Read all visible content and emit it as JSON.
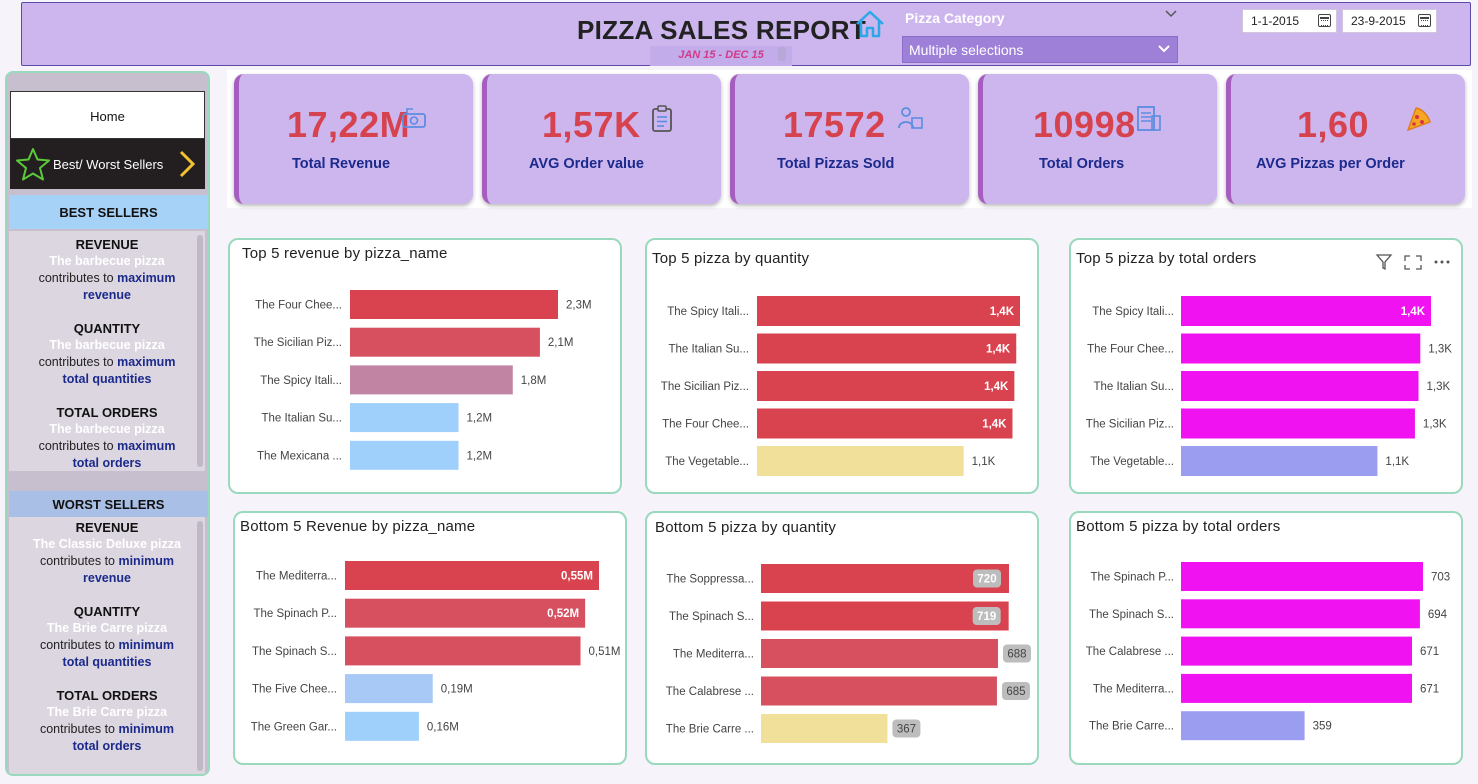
{
  "header": {
    "title": "PIZZA SALES REPORT",
    "subtitle": "JAN 15 - DEC 15",
    "category_label": "Pizza Category",
    "category_value": "Multiple selections",
    "date_start": "1-1-2015",
    "date_end": "23-9-2015"
  },
  "sidebar": {
    "home_label": "Home",
    "best_worst_label": "Best/ Worst Sellers",
    "best": {
      "heading": "BEST SELLERS",
      "blocks": [
        {
          "title": "REVENUE",
          "item": "The barbecue pizza",
          "mid": "contributes to ",
          "em1": "maximum",
          "em2": "revenue"
        },
        {
          "title": "QUANTITY",
          "item": "The barbecue pizza",
          "mid": "contributes to ",
          "em1": "maximum",
          "em2": "total quantities"
        },
        {
          "title": "TOTAL ORDERS",
          "item": "The barbecue pizza",
          "mid": "contributes to ",
          "em1": "maximum",
          "em2": "total orders"
        }
      ]
    },
    "worst": {
      "heading": "WORST SELLERS",
      "blocks": [
        {
          "title": "REVENUE",
          "item": "The Classic Deluxe pizza",
          "mid": "contributes to ",
          "em1": "minimum",
          "em2": "revenue"
        },
        {
          "title": "QUANTITY",
          "item": "The Brie Carre pizza",
          "mid": "contributes to ",
          "em1": "minimum",
          "em2": "total quantities"
        },
        {
          "title": "TOTAL ORDERS",
          "item": "The Brie Carre  pizza",
          "mid": "contributes to ",
          "em1": "minimum",
          "em2": "total orders"
        }
      ]
    }
  },
  "kpis": [
    {
      "value": "17,22M",
      "label": "Total Revenue",
      "icon": "money-hand-icon"
    },
    {
      "value": "1,57K",
      "label": "AVG Order value",
      "icon": "clipboard-icon"
    },
    {
      "value": "17572",
      "label": "Total Pizzas Sold",
      "icon": "delivery-person-icon"
    },
    {
      "value": "10998",
      "label": "Total Orders",
      "icon": "receipt-list-icon"
    },
    {
      "value": "1,60",
      "label": "AVG Pizzas per Order",
      "icon": "pizza-slice-icon"
    }
  ],
  "colors": {
    "red": "#d9434f",
    "red2": "#d65060",
    "mauve": "#c284a3",
    "lightblue": "#9fd0fb",
    "blue2": "#a8c8f5",
    "yellow": "#f0e09a",
    "magenta": "#f012f0",
    "periwinkle": "#9b9ef0"
  },
  "chart_data": [
    {
      "type": "bar",
      "orientation": "horizontal",
      "title": "Top 5 revenue by pizza_name",
      "categories": [
        "The Four Chee...",
        "The Sicilian Piz...",
        "The Spicy Itali...",
        "The Italian Su...",
        "The Mexicana ..."
      ],
      "values": [
        2.3,
        2.1,
        1.8,
        1.2,
        1.2
      ],
      "labels": [
        "2,3M",
        "2,1M",
        "1,8M",
        "1,2M",
        "1,2M"
      ],
      "max": 2.3,
      "colors": [
        "#d9434f",
        "#d65060",
        "#c284a3",
        "#9fd0fb",
        "#9fd0fb"
      ],
      "label_style": "outside"
    },
    {
      "type": "bar",
      "orientation": "horizontal",
      "title": "Top 5 pizza by quantity",
      "categories": [
        "The Spicy Itali...",
        "The Italian Su...",
        "The Sicilian Piz...",
        "The Four Chee...",
        "The Vegetable..."
      ],
      "values": [
        1.4,
        1.38,
        1.37,
        1.36,
        1.1
      ],
      "labels": [
        "1,4K",
        "1,4K",
        "1,4K",
        "1,4K",
        "1,1K"
      ],
      "max": 1.4,
      "colors": [
        "#d9434f",
        "#d9434f",
        "#d9434f",
        "#d9434f",
        "#f0e09a"
      ],
      "label_style": "inside-last-outside"
    },
    {
      "type": "bar",
      "orientation": "horizontal",
      "title": "Top 5 pizza by total orders",
      "categories": [
        "The Spicy Itali...",
        "The Four Chee...",
        "The Italian Su...",
        "The Sicilian Piz...",
        "The Vegetable..."
      ],
      "values": [
        1.4,
        1.34,
        1.33,
        1.31,
        1.1
      ],
      "labels": [
        "1,4K",
        "1,3K",
        "1,3K",
        "1,3K",
        "1,1K"
      ],
      "max": 1.4,
      "colors": [
        "#f012f0",
        "#f012f0",
        "#f012f0",
        "#f012f0",
        "#9b9ef0"
      ],
      "label_style": "inside-first"
    },
    {
      "type": "bar",
      "orientation": "horizontal",
      "title": "Bottom 5 Revenue by pizza_name",
      "categories": [
        "The Mediterra...",
        "The Spinach P...",
        "The Spinach S...",
        "The Five Chee...",
        "The Green Gar..."
      ],
      "values": [
        0.55,
        0.52,
        0.51,
        0.19,
        0.16
      ],
      "labels": [
        "0,55M",
        "0,52M",
        "0,51M",
        "0,19M",
        "0,16M"
      ],
      "max": 0.55,
      "colors": [
        "#d9434f",
        "#d65060",
        "#d65060",
        "#a8c8f5",
        "#9fd0fb"
      ],
      "label_style": "inside-first-two"
    },
    {
      "type": "bar",
      "orientation": "horizontal",
      "title": "Bottom 5 pizza by quantity",
      "categories": [
        "The Soppressa...",
        "The Spinach S...",
        "The Mediterra...",
        "The Calabrese ...",
        "The Brie Carre ..."
      ],
      "values": [
        720,
        719,
        688,
        685,
        367
      ],
      "labels": [
        "720",
        "719",
        "688",
        "685",
        "367"
      ],
      "max": 720,
      "colors": [
        "#d9434f",
        "#d9434f",
        "#d65060",
        "#d65060",
        "#f0e09a"
      ],
      "label_style": "pill"
    },
    {
      "type": "bar",
      "orientation": "horizontal",
      "title": "Bottom 5 pizza by total orders",
      "categories": [
        "The Spinach P...",
        "The Spinach S...",
        "The Calabrese ...",
        "The Mediterra...",
        "The Brie Carre..."
      ],
      "values": [
        703,
        694,
        671,
        671,
        359
      ],
      "labels": [
        "703",
        "694",
        "671",
        "671",
        "359"
      ],
      "max": 703,
      "colors": [
        "#f012f0",
        "#f012f0",
        "#f012f0",
        "#f012f0",
        "#9b9ef0"
      ],
      "label_style": "outside"
    }
  ]
}
